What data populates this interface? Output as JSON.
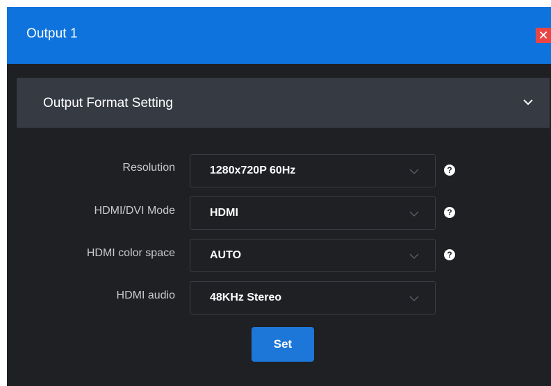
{
  "window": {
    "title": "Output 1",
    "close_glyph": "✕"
  },
  "section": {
    "title": "Output Format Setting",
    "expand_icon": "chevron-down-icon"
  },
  "fields": [
    {
      "label": "Resolution",
      "value": "1280x720P 60Hz",
      "has_help": true
    },
    {
      "label": "HDMI/DVI Mode",
      "value": "HDMI",
      "has_help": true
    },
    {
      "label": "HDMI color space",
      "value": "AUTO",
      "has_help": true
    },
    {
      "label": "HDMI audio",
      "value": "48KHz Stereo",
      "has_help": false
    }
  ],
  "help_glyph": "?",
  "actions": {
    "set_label": "Set"
  },
  "colors": {
    "accent": "#0f73dd",
    "close": "#e94545",
    "background": "#1f2024",
    "section_header": "#353a43"
  }
}
